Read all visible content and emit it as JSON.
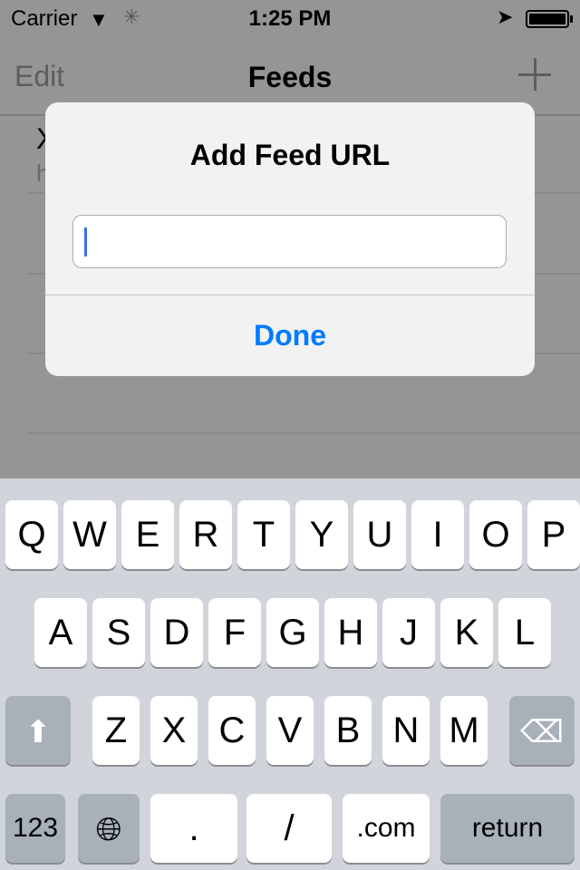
{
  "status_bar": {
    "carrier": "Carrier",
    "time": "1:25 PM"
  },
  "nav": {
    "edit": "Edit",
    "title": "Feeds"
  },
  "list": {
    "row1_title": "X",
    "row1_subtitle": "h"
  },
  "alert": {
    "title": "Add Feed URL",
    "input_value": "",
    "done": "Done",
    "accent": "#007aff"
  },
  "keyboard": {
    "row1": [
      "Q",
      "W",
      "E",
      "R",
      "T",
      "Y",
      "U",
      "I",
      "O",
      "P"
    ],
    "row2": [
      "A",
      "S",
      "D",
      "F",
      "G",
      "H",
      "J",
      "K",
      "L"
    ],
    "row3": [
      "Z",
      "X",
      "C",
      "V",
      "B",
      "N",
      "M"
    ],
    "numbers": "123",
    "dot": ".",
    "slash": "/",
    "dotcom": ".com",
    "return": "return"
  }
}
